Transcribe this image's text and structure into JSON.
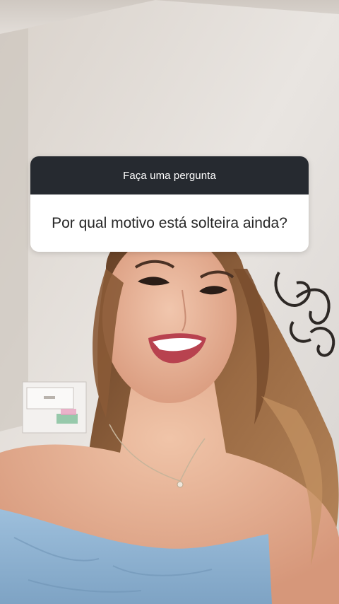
{
  "question_sticker": {
    "prompt": "Faça uma pergunta",
    "question": "Por qual motivo está solteira ainda?"
  },
  "colors": {
    "sticker_header_bg": "#262a30",
    "sticker_body_bg": "#ffffff",
    "wall": "#e4dfd9",
    "hair": "#8a5a36",
    "skin": "#e8b69c",
    "top": "#8fb2cf"
  }
}
